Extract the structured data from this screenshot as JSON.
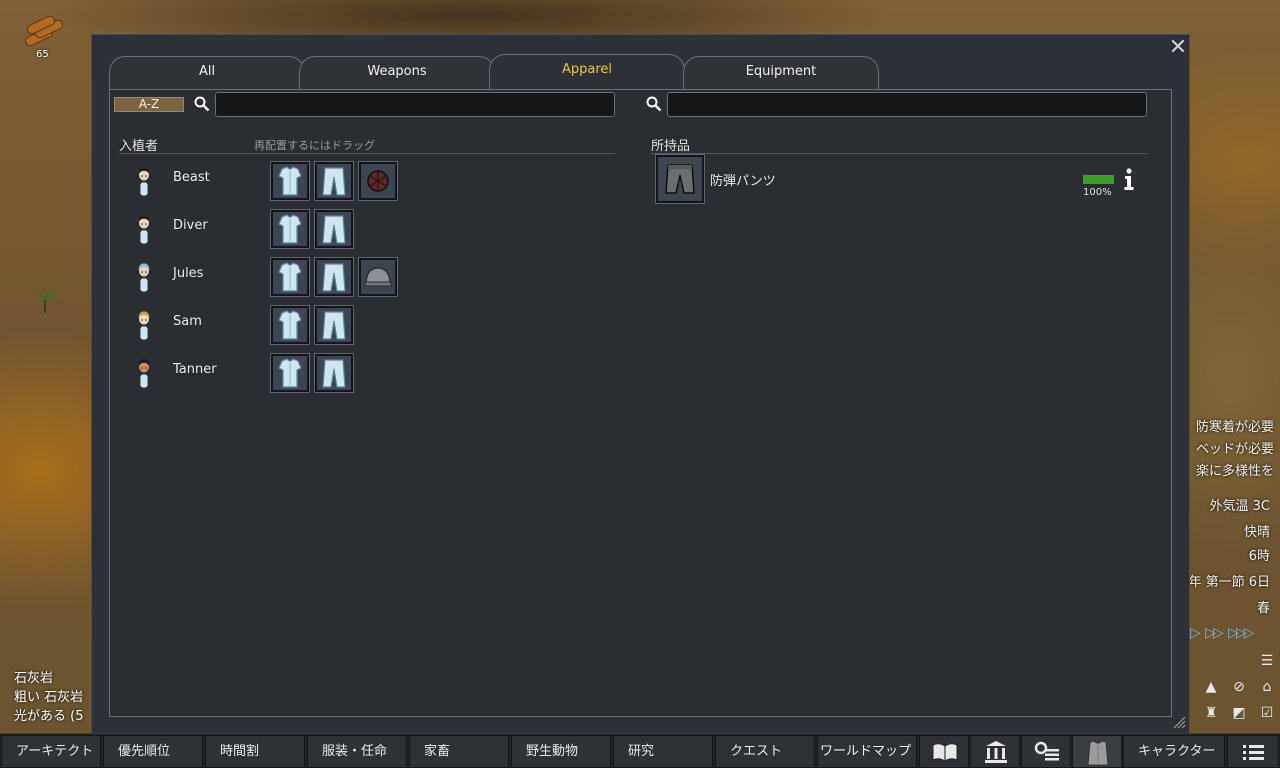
{
  "map": {
    "resource_count": "65"
  },
  "hud": {
    "alerts": [
      "防寒着が必要",
      "ベッドが必要",
      "楽に多様性を"
    ],
    "temperature": "外気温 3C",
    "weather": "快晴",
    "hour": "6時",
    "date": "年 第一節 6日",
    "season": "春",
    "terrain": [
      "石灰岩",
      "粗い 石灰岩",
      "光がある (5"
    ]
  },
  "dialog": {
    "close_label": "✕",
    "tabs": [
      {
        "label": "All",
        "active": false
      },
      {
        "label": "Weapons",
        "active": false
      },
      {
        "label": "Apparel",
        "active": true
      },
      {
        "label": "Equipment",
        "active": false
      }
    ],
    "sort_label": "A-Z",
    "left_search": {
      "value": "",
      "placeholder": ""
    },
    "right_search": {
      "value": "",
      "placeholder": ""
    },
    "colonists_header": "入植者",
    "drag_hint": "再配置するにはドラッグ",
    "inventory_header": "所持品",
    "colonists": [
      {
        "name": "Beast",
        "hair": "#1e1e1e",
        "skin": "#e9d4c0",
        "apparel": [
          "shirt",
          "pants",
          "vest"
        ]
      },
      {
        "name": "Diver",
        "hair": "#2a2018",
        "skin": "#ecd7c4",
        "apparel": [
          "shirt",
          "pants"
        ]
      },
      {
        "name": "Jules",
        "hair": "#9cb6c0",
        "skin": "#e6d1bd",
        "apparel": [
          "shirt",
          "pants",
          "helmet"
        ]
      },
      {
        "name": "Sam",
        "hair": "#c79a4d",
        "skin": "#efd9c3",
        "apparel": [
          "shirt",
          "pants"
        ]
      },
      {
        "name": "Tanner",
        "hair": "#241b16",
        "skin": "#c58f6b",
        "apparel": [
          "shirt",
          "pants"
        ]
      }
    ],
    "inventory": [
      {
        "name": "防弾パンツ",
        "hit_points_percent": 100,
        "hit_points_label": "100%",
        "icon": "flak-pants-icon"
      }
    ]
  },
  "bottom_bar": [
    {
      "label": "アーキテクト"
    },
    {
      "label": "優先順位"
    },
    {
      "label": "時間割"
    },
    {
      "label": "服装・任命"
    },
    {
      "label": "家畜"
    },
    {
      "label": "野生動物"
    },
    {
      "label": "研究"
    },
    {
      "label": "クエスト"
    },
    {
      "label": "ワールドマップ"
    },
    {
      "icon": "book-icon"
    },
    {
      "icon": "factions-icon"
    },
    {
      "icon": "history-icon"
    },
    {
      "icon": "apparel-icon"
    },
    {
      "label": "キャラクター"
    },
    {
      "icon": "menu-icon"
    }
  ],
  "colors": {
    "active_tab": "#e8c33c",
    "hp_bar": "#39a027",
    "panel_bg": "#2a2d31"
  }
}
